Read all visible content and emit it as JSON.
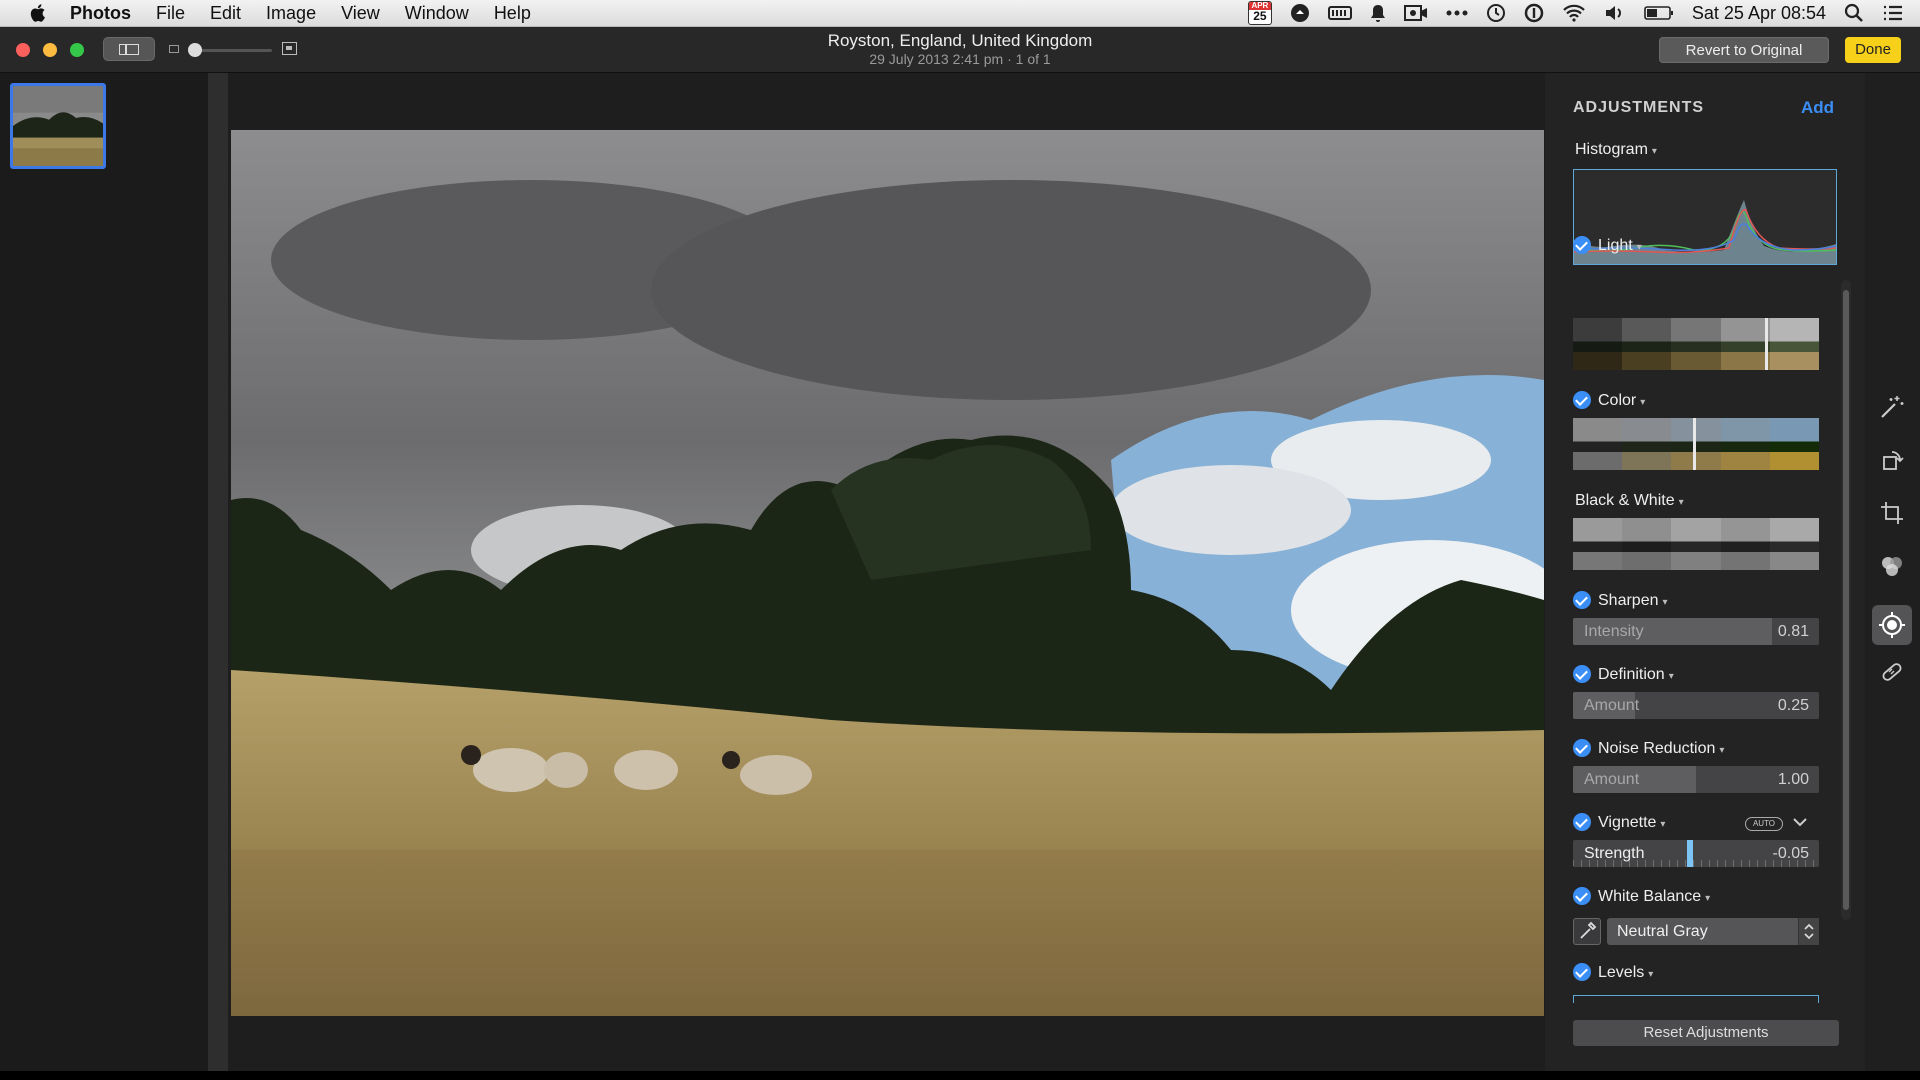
{
  "menubar": {
    "app_name": "Photos",
    "menus": [
      "File",
      "Edit",
      "Image",
      "View",
      "Window",
      "Help"
    ],
    "calendar_badge": {
      "month": "APR",
      "day": "25"
    },
    "datetime": "Sat 25 Apr  08:54",
    "icons": [
      "calendar-icon",
      "sync-icon",
      "battery-meter-icon",
      "notification-icon",
      "screen-record-icon",
      "more-icon",
      "time-machine-icon",
      "info-icon",
      "wifi-icon",
      "volume-icon",
      "battery-icon",
      "search-icon",
      "list-icon"
    ]
  },
  "titlebar": {
    "title": "Royston, England, United Kingdom",
    "subtitle": "29 July 2013 2:41 pm  ·  1 of 1",
    "revert_label": "Revert to Original",
    "done_label": "Done"
  },
  "panel": {
    "heading": "ADJUSTMENTS",
    "add_label": "Add",
    "histogram_label": "Histogram",
    "sections": {
      "light": "Light",
      "color": "Color",
      "bw": "Black & White",
      "sharpen": "Sharpen",
      "definition": "Definition",
      "noise": "Noise Reduction",
      "vignette": "Vignette",
      "white_balance": "White Balance",
      "levels": "Levels"
    },
    "sharpen_slider": {
      "label": "Intensity",
      "value": "0.81",
      "fraction": 0.81
    },
    "definition_slider": {
      "label": "Amount",
      "value": "0.25",
      "fraction": 0.25
    },
    "noise_slider": {
      "label": "Amount",
      "value": "1.00",
      "fraction": 0.5
    },
    "vignette_slider": {
      "label": "Strength",
      "value": "-0.05",
      "fraction": 0.475
    },
    "auto_label": "AUTO",
    "white_balance_value": "Neutral Gray",
    "reset_label": "Reset Adjustments"
  },
  "tools": [
    "magic-wand-icon",
    "rotate-icon",
    "crop-icon",
    "filters-icon",
    "adjust-icon",
    "retouch-icon"
  ],
  "colors": {
    "accent": "#3a8ef6",
    "done": "#f7d01a",
    "selection": "#3c78e8"
  }
}
